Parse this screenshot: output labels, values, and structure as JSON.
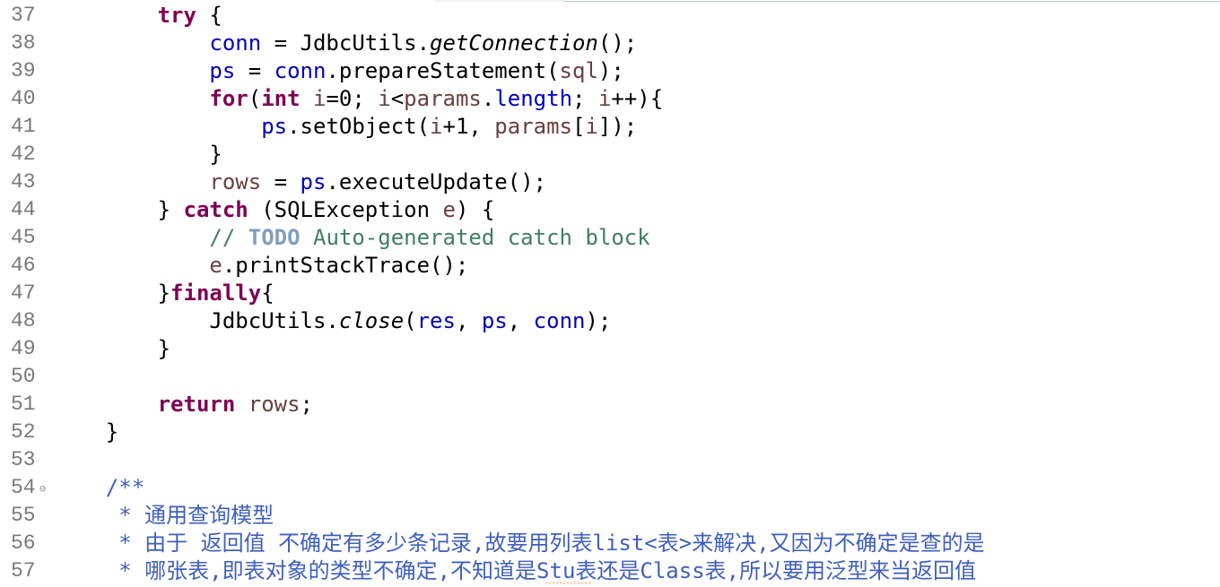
{
  "editor": {
    "lines": [
      {
        "num": "37",
        "indent": "        ",
        "tokens": [
          {
            "t": "try",
            "c": "kw"
          },
          {
            "t": " {",
            "c": ""
          }
        ]
      },
      {
        "num": "38",
        "indent": "            ",
        "tokens": [
          {
            "t": "conn",
            "c": "field"
          },
          {
            "t": " = JdbcUtils.",
            "c": ""
          },
          {
            "t": "getConnection",
            "c": "italic"
          },
          {
            "t": "();",
            "c": ""
          }
        ]
      },
      {
        "num": "39",
        "indent": "            ",
        "tokens": [
          {
            "t": "ps",
            "c": "field"
          },
          {
            "t": " = ",
            "c": ""
          },
          {
            "t": "conn",
            "c": "field"
          },
          {
            "t": ".prepareStatement(",
            "c": ""
          },
          {
            "t": "sql",
            "c": "local"
          },
          {
            "t": ");",
            "c": ""
          }
        ]
      },
      {
        "num": "40",
        "indent": "            ",
        "tokens": [
          {
            "t": "for",
            "c": "kw"
          },
          {
            "t": "(",
            "c": ""
          },
          {
            "t": "int",
            "c": "kw"
          },
          {
            "t": " ",
            "c": ""
          },
          {
            "t": "i",
            "c": "local"
          },
          {
            "t": "=0; ",
            "c": ""
          },
          {
            "t": "i",
            "c": "local"
          },
          {
            "t": "<",
            "c": ""
          },
          {
            "t": "params",
            "c": "local"
          },
          {
            "t": ".",
            "c": ""
          },
          {
            "t": "length",
            "c": "field"
          },
          {
            "t": "; ",
            "c": ""
          },
          {
            "t": "i",
            "c": "local"
          },
          {
            "t": "++){",
            "c": ""
          }
        ]
      },
      {
        "num": "41",
        "indent": "                ",
        "tokens": [
          {
            "t": "ps",
            "c": "field"
          },
          {
            "t": ".setObject(",
            "c": ""
          },
          {
            "t": "i",
            "c": "local"
          },
          {
            "t": "+1, ",
            "c": ""
          },
          {
            "t": "params",
            "c": "local"
          },
          {
            "t": "[",
            "c": ""
          },
          {
            "t": "i",
            "c": "local"
          },
          {
            "t": "]);",
            "c": ""
          }
        ]
      },
      {
        "num": "42",
        "indent": "            ",
        "tokens": [
          {
            "t": "}",
            "c": ""
          }
        ]
      },
      {
        "num": "43",
        "indent": "            ",
        "tokens": [
          {
            "t": "rows",
            "c": "local"
          },
          {
            "t": " = ",
            "c": ""
          },
          {
            "t": "ps",
            "c": "field"
          },
          {
            "t": ".executeUpdate();",
            "c": ""
          }
        ]
      },
      {
        "num": "44",
        "indent": "        ",
        "tokens": [
          {
            "t": "} ",
            "c": ""
          },
          {
            "t": "catch",
            "c": "kw"
          },
          {
            "t": " (SQLException ",
            "c": ""
          },
          {
            "t": "e",
            "c": "local"
          },
          {
            "t": ") {",
            "c": ""
          }
        ]
      },
      {
        "num": "45",
        "indent": "            ",
        "tokens": [
          {
            "t": "// ",
            "c": "comment"
          },
          {
            "t": "TODO",
            "c": "todo"
          },
          {
            "t": " Auto-generated catch block",
            "c": "comment"
          }
        ]
      },
      {
        "num": "46",
        "indent": "            ",
        "tokens": [
          {
            "t": "e",
            "c": "local"
          },
          {
            "t": ".printStackTrace();",
            "c": ""
          }
        ]
      },
      {
        "num": "47",
        "indent": "        ",
        "tokens": [
          {
            "t": "}",
            "c": ""
          },
          {
            "t": "finally",
            "c": "kw"
          },
          {
            "t": "{",
            "c": ""
          }
        ]
      },
      {
        "num": "48",
        "indent": "            ",
        "tokens": [
          {
            "t": "JdbcUtils.",
            "c": ""
          },
          {
            "t": "close",
            "c": "italic"
          },
          {
            "t": "(",
            "c": ""
          },
          {
            "t": "res",
            "c": "field"
          },
          {
            "t": ", ",
            "c": ""
          },
          {
            "t": "ps",
            "c": "field"
          },
          {
            "t": ", ",
            "c": ""
          },
          {
            "t": "conn",
            "c": "field"
          },
          {
            "t": ");",
            "c": ""
          }
        ]
      },
      {
        "num": "49",
        "indent": "        ",
        "tokens": [
          {
            "t": "}",
            "c": ""
          }
        ]
      },
      {
        "num": "50",
        "indent": "",
        "tokens": []
      },
      {
        "num": "51",
        "indent": "        ",
        "tokens": [
          {
            "t": "return",
            "c": "kw"
          },
          {
            "t": " ",
            "c": ""
          },
          {
            "t": "rows",
            "c": "local"
          },
          {
            "t": ";",
            "c": ""
          }
        ]
      },
      {
        "num": "52",
        "indent": "    ",
        "tokens": [
          {
            "t": "}",
            "c": ""
          }
        ]
      },
      {
        "num": "53",
        "indent": "",
        "tokens": []
      },
      {
        "num": "54",
        "indent": "    ",
        "fold": "⊖",
        "tokens": [
          {
            "t": "/**",
            "c": "javadoc"
          }
        ]
      },
      {
        "num": "55",
        "indent": "     ",
        "tokens": [
          {
            "t": "* 通用查询模型",
            "c": "javadoc"
          }
        ]
      },
      {
        "num": "56",
        "indent": "     ",
        "tokens": [
          {
            "t": "* 由于 返回值 不确定有多少条记录,故要用列表list<表>来解决,又因为不确定是查的是",
            "c": "javadoc"
          }
        ]
      },
      {
        "num": "57",
        "indent": "     ",
        "tokens": [
          {
            "t": "* 哪张表,即表对象的类型不确定,不知道是Stu表还是Class表,所以要用泛型来当返回值",
            "c": "javadoc"
          }
        ]
      }
    ]
  },
  "colors": {
    "keyword": "#7f0055",
    "field": "#0000c0",
    "local_variable": "#6a3e3e",
    "comment": "#3f7f5f",
    "task_tag": "#7f9fbf",
    "javadoc": "#3f5fbf",
    "line_number": "#787878",
    "spell_warning": "#e0a050"
  }
}
